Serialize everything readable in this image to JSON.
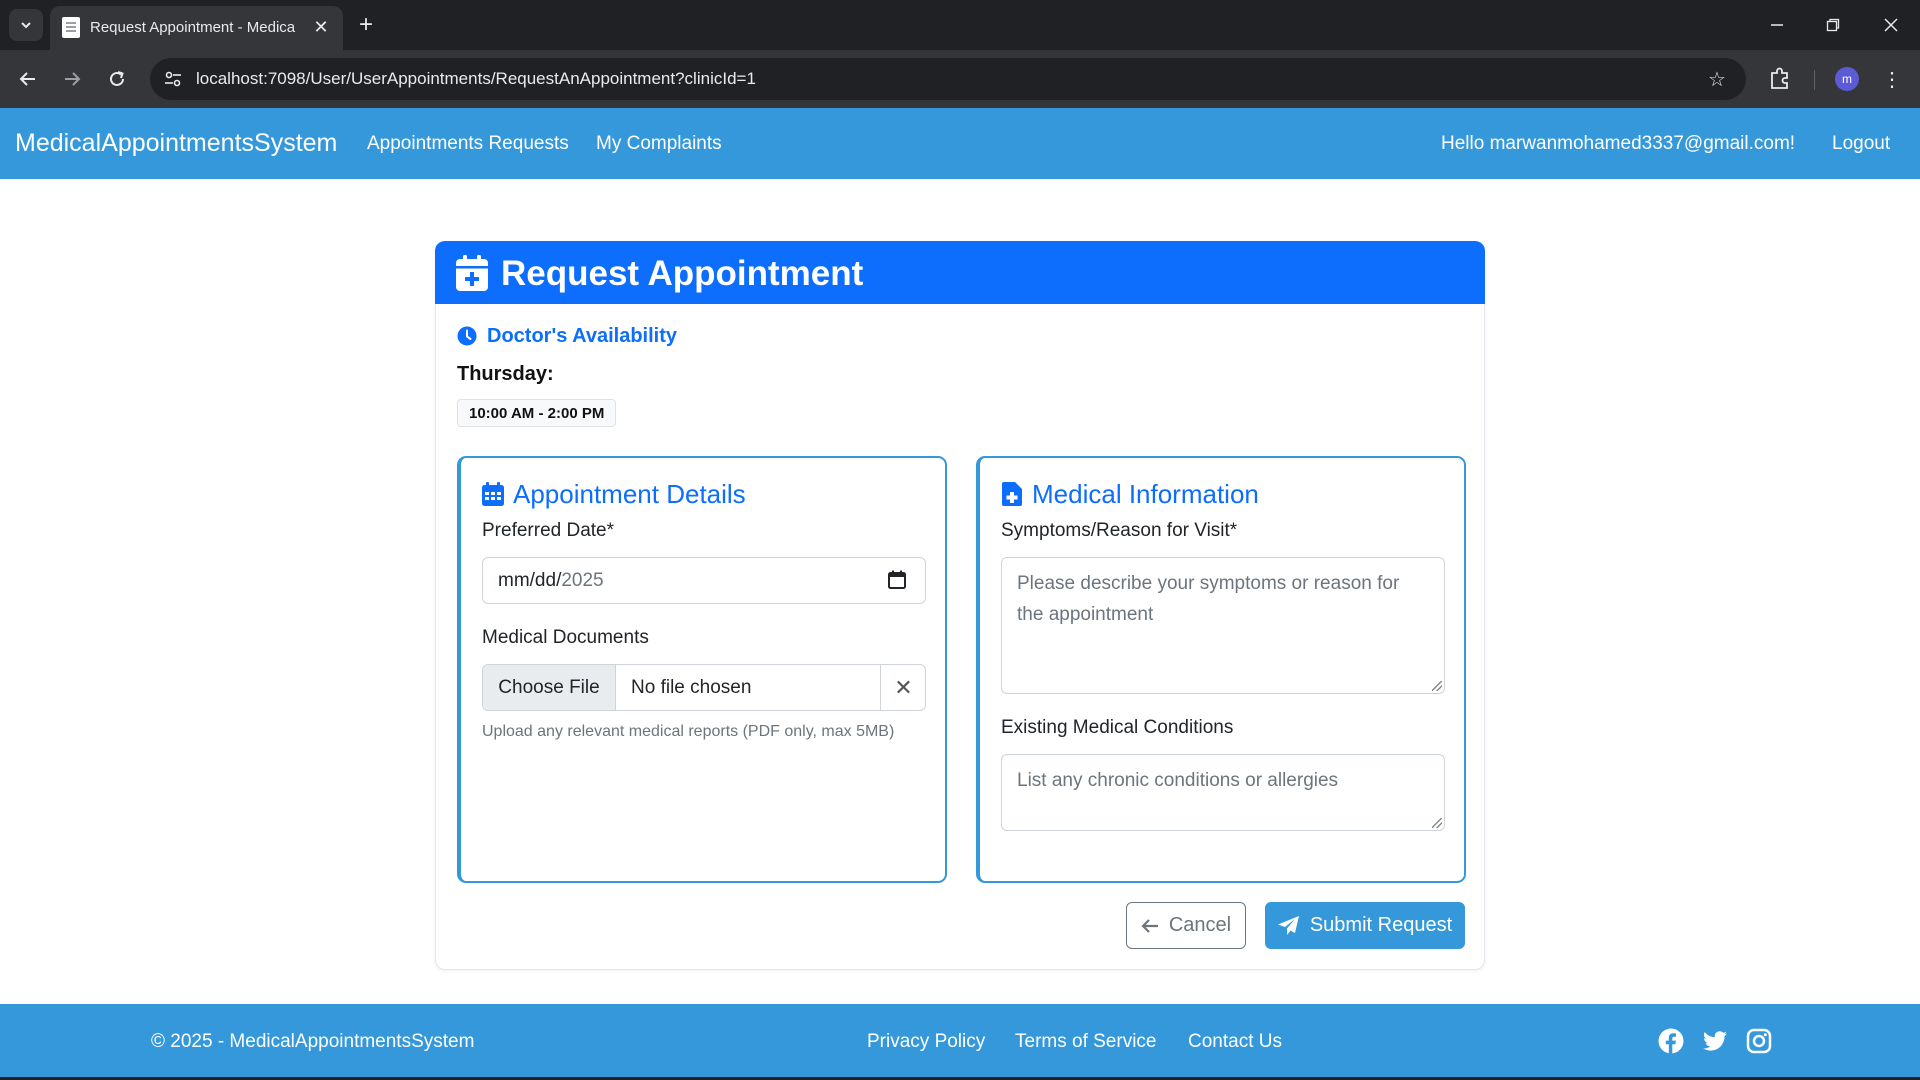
{
  "browser": {
    "tab_title": "Request Appointment - Medica",
    "url": "localhost:7098/User/UserAppointments/RequestAnAppointment?clinicId=1",
    "profile_initial": "m",
    "icons": [
      "tab-search-icon",
      "document-icon",
      "close-icon",
      "plus-icon",
      "minimize-icon",
      "restore-icon",
      "close-window-icon",
      "back-arrow-icon",
      "forward-arrow-icon",
      "reload-icon",
      "site-info-icon",
      "bookmark-star-icon",
      "extensions-icon",
      "kebab-menu-icon"
    ]
  },
  "navbar": {
    "brand": "MedicalAppointmentsSystem",
    "links": [
      {
        "label": "Appointments Requests"
      },
      {
        "label": "My Complaints"
      }
    ],
    "greeting": "Hello marwanmohamed3337@gmail.com!",
    "logout": "Logout"
  },
  "card": {
    "title": "Request Appointment",
    "availability": {
      "title": "Doctor's Availability",
      "day": "Thursday:",
      "slot": "10:00 AM - 2:00 PM"
    },
    "appointment_details": {
      "title": "Appointment Details",
      "date_label": "Preferred Date*",
      "date_placeholder_mmdd": "mm/dd/",
      "date_year": "2025",
      "documents_label": "Medical Documents",
      "choose_file": "Choose File",
      "no_file": "No file chosen",
      "clear": "✕",
      "help_text": "Upload any relevant medical reports (PDF only, max 5MB)"
    },
    "medical_information": {
      "title": "Medical Information",
      "symptoms_label": "Symptoms/Reason for Visit*",
      "symptoms_placeholder": "Please describe your symptoms or reason for the appointment",
      "conditions_label": "Existing Medical Conditions",
      "conditions_placeholder": "List any chronic conditions or allergies"
    },
    "buttons": {
      "cancel": "Cancel",
      "submit": "Submit Request"
    }
  },
  "footer": {
    "copyright": "© 2025 - MedicalAppointmentsSystem",
    "links": [
      "Privacy Policy",
      "Terms of Service",
      "Contact Us"
    ],
    "social": [
      "facebook-icon",
      "twitter-icon",
      "instagram-icon"
    ]
  },
  "colors": {
    "navbar": "#3498db",
    "card_header": "#0d6efd",
    "accent_text": "#0d6efd",
    "browser_dark": "#202124"
  }
}
